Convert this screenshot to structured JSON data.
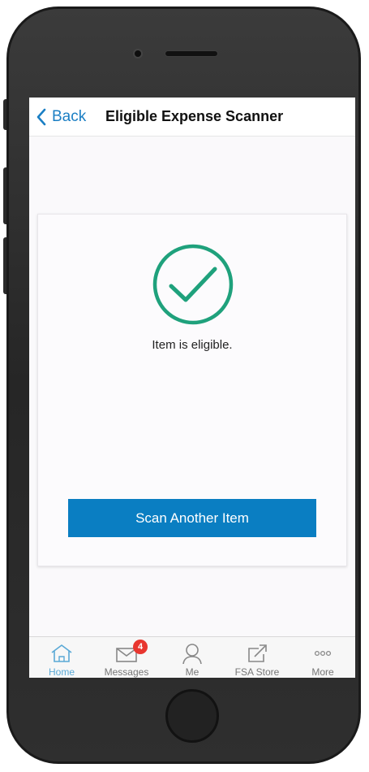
{
  "nav": {
    "back_label": "Back",
    "title": "Eligible Expense Scanner"
  },
  "result": {
    "icon": "checkmark-circle-icon",
    "message": "Item is eligible.",
    "button_label": "Scan Another Item"
  },
  "tabs": [
    {
      "label": "Home",
      "icon": "home-icon",
      "active": true
    },
    {
      "label": "Messages",
      "icon": "envelope-icon",
      "badge": "4"
    },
    {
      "label": "Me",
      "icon": "person-icon"
    },
    {
      "label": "FSA Store",
      "icon": "external-link-icon"
    },
    {
      "label": "More",
      "icon": "more-dots-icon"
    }
  ],
  "colors": {
    "accent": "#0a7ec2",
    "link": "#1b7fc4",
    "success": "#1fa17c",
    "badge": "#e8362f",
    "tab_active": "#5aa9d6"
  }
}
